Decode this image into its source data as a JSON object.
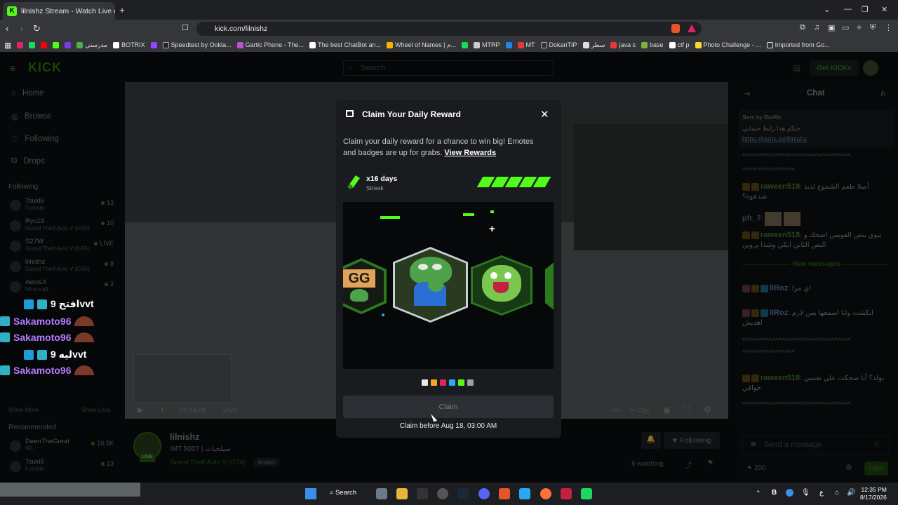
{
  "browser": {
    "tab_title": "lilnishz Stream - Watch Live on K",
    "url": "kick.com/lilnishz",
    "bookmarks": [
      "مدرستي",
      "BOTRIX",
      "Speedtest by Ookla...",
      "Gartic Phone - The...",
      "The best ChatBot an...",
      "Wheel of Names | م...",
      "MTRP",
      "MT",
      "DokanTIP",
      "سطر",
      "java s",
      "base",
      "ctf p",
      "Photo Challenge - ...",
      "Imported from Go..."
    ]
  },
  "kick": {
    "logo": "KICK",
    "search_placeholder": "Search",
    "get_kicks": "Get KICKs",
    "nav": [
      "Home",
      "Browse",
      "Following",
      "Drops"
    ],
    "following_title": "Following",
    "following": [
      {
        "name": "Tsuki6",
        "game": "Fortnite",
        "viewers": "13"
      },
      {
        "name": "Ryo19",
        "game": "Grand Theft Auto V (GTA)",
        "viewers": "10"
      },
      {
        "name": "S27W",
        "game": "Grand Theft Auto V (GTA)",
        "viewers": "LIVE"
      },
      {
        "name": "lilnishz",
        "game": "Grand Theft Auto V (GTA)",
        "viewers": "8"
      },
      {
        "name": "AetosX",
        "game": "Minecraft",
        "viewers": "2"
      }
    ],
    "show_more": "Show More",
    "show_less": "Show Less",
    "recommended_title": "Recommended",
    "recommended": [
      {
        "name": "DeenTheGreat",
        "game": "IRL",
        "viewers": "16.5K"
      },
      {
        "name": "Tsuki6",
        "game": "Fortnite",
        "viewers": "13"
      }
    ],
    "video": {
      "time": "04:04:09",
      "live": "LIVE",
      "clip": "Clip"
    },
    "stream": {
      "streamer": "lilnishz",
      "title": "!MT 500? | سيلجيات",
      "category": "Grand Theft Auto V (GTA)",
      "tag": "Arabic",
      "watching": "8 watching",
      "following_btn": "Following"
    },
    "chat": {
      "title": "Chat",
      "pinned_sender": "Sent by BotRix",
      "pinned_msg": "حيكم هذا رابط حسابي",
      "pinned_link": "https://guns.lol/lilnishz",
      "new_messages": "New messages",
      "messages": [
        {
          "user": "raween518",
          "text": "أصلا طعم الشموع لذيذ شدعوة؟"
        },
        {
          "user": "pfr_7",
          "text": ""
        },
        {
          "user": "raween518",
          "text": "يبوي بنص الفويس اضحك و النص الثاني ابكي وشذا يروين"
        },
        {
          "user": "lIRoz",
          "text": "اي مرا"
        },
        {
          "user": "lIRoz",
          "text": "انكشت وانا اسمعها بس لازم اهديش"
        },
        {
          "user": "raween518",
          "text": "بولد؟ أنا ضحكت على نفسي حواقي"
        }
      ],
      "input_placeholder": "Send a message",
      "points": "200",
      "chat_btn": "Chat"
    }
  },
  "overlay_chat": [
    {
      "user": "",
      "msg": "افتح 9vvt"
    },
    {
      "user": "Sakamoto96",
      "msg": ""
    },
    {
      "user": "Sakamoto96",
      "msg": ""
    },
    {
      "user": "",
      "msg": "ليه 9vvt"
    },
    {
      "user": "Sakamoto96",
      "msg": ""
    }
  ],
  "modal": {
    "title": "Claim Your Daily Reward",
    "desc": "Claim your daily reward for a chance to win big! Emotes and badges are up for grabs.",
    "view_rewards": "View Rewards",
    "streak_days": "x16 days",
    "streak_label": "Streak",
    "streak_bars": 5,
    "emote_gg": "GG",
    "claim": "Claim",
    "claim_before": "Claim before Aug 18, 03:00 AM",
    "rarity_colors": [
      "#e8e8e8",
      "#f5a623",
      "#e2245a",
      "#2aa9f2",
      "#53fc18",
      "#9aa0a3"
    ]
  },
  "taskbar": {
    "search": "Search",
    "time": "12:35 PM",
    "date": "8/17/2026"
  }
}
